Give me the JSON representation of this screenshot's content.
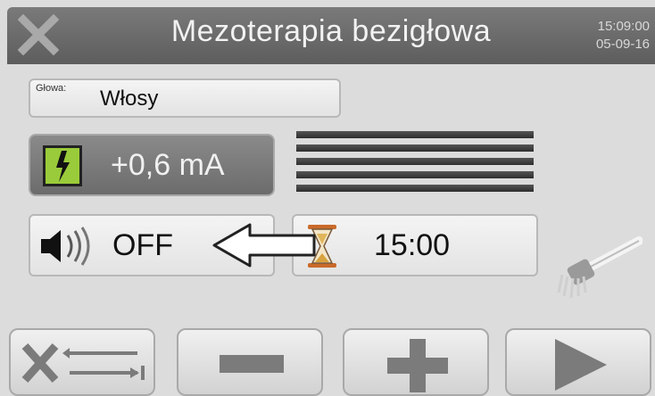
{
  "header": {
    "title": "Mezoterapia bezigłowa",
    "time": "15:09:00",
    "date": "05-09-16",
    "close_icon": "close-icon"
  },
  "head_field": {
    "label": "Głowa:",
    "value": "Włosy"
  },
  "current": {
    "value": "+0,6 mA",
    "icon": "lightning-icon"
  },
  "intensity_bars": {
    "count": 5
  },
  "sound": {
    "value": "OFF",
    "icon": "speaker-icon"
  },
  "timer": {
    "value": "15:00",
    "icon": "hourglass-icon"
  },
  "buttons": {
    "cancel": "cancel-swap-button",
    "minus": "minus-button",
    "plus": "plus-button",
    "play": "play-button"
  },
  "colors": {
    "header": "#6b6b6b",
    "indicator": "#9acb3b"
  }
}
